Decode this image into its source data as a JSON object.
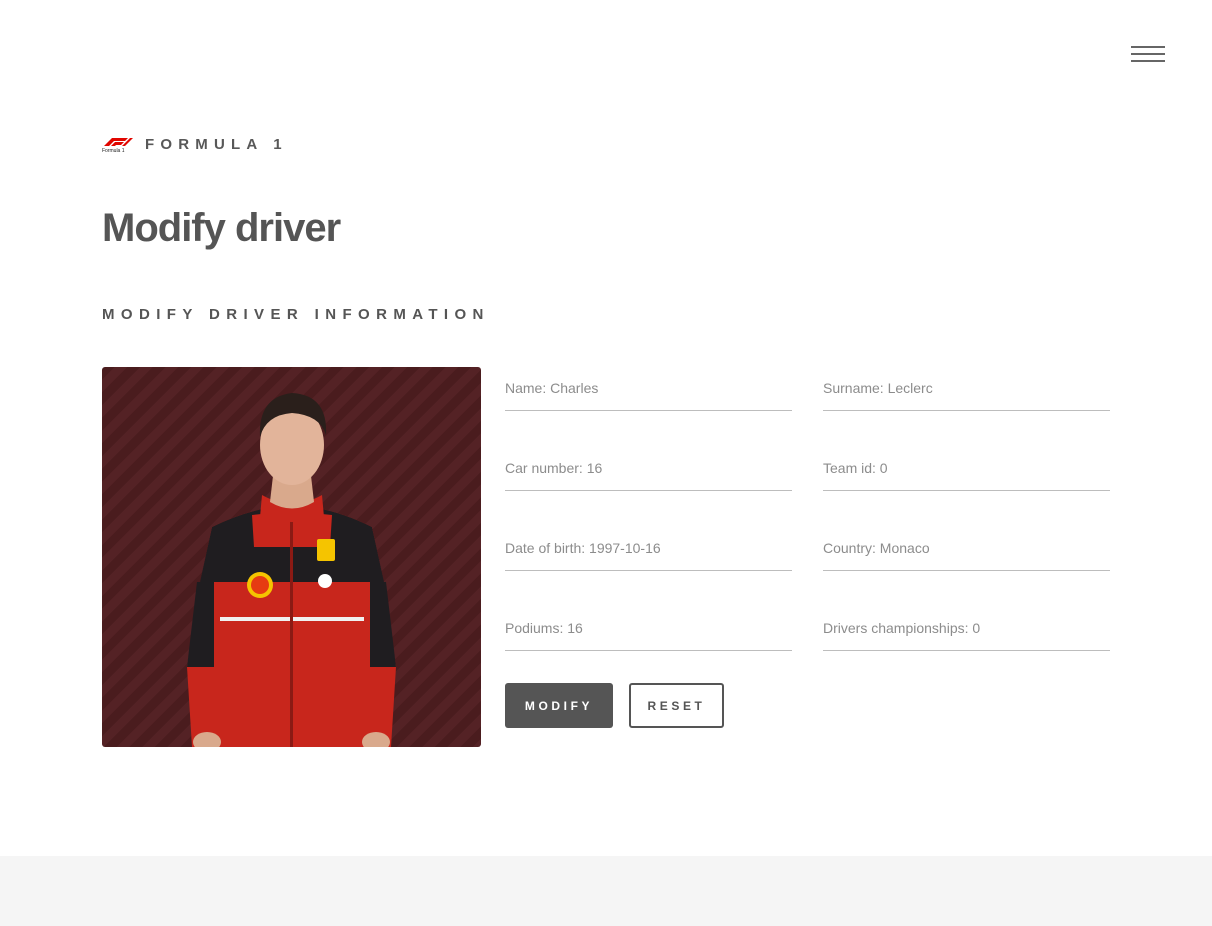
{
  "header": {
    "brand_name": "FORMULA 1",
    "logo_text": "Formula 1"
  },
  "page": {
    "title": "Modify driver",
    "section_title": "MODIFY DRIVER INFORMATION"
  },
  "driver": {
    "photo_icon": "driver-portrait",
    "fields": {
      "name": "Name: Charles",
      "surname": "Surname: Leclerc",
      "car_number": "Car number: 16",
      "team_id": "Team id: 0",
      "date_of_birth": "Date of birth: 1997-10-16",
      "country": "Country: Monaco",
      "podiums": "Podiums: 16",
      "drivers_championships": "Drivers championships: 0"
    }
  },
  "actions": {
    "modify_label": "MODIFY",
    "reset_label": "RESET"
  },
  "colors": {
    "accent": "#555555",
    "f1_red": "#e10600",
    "suit_red": "#d52b1e"
  }
}
